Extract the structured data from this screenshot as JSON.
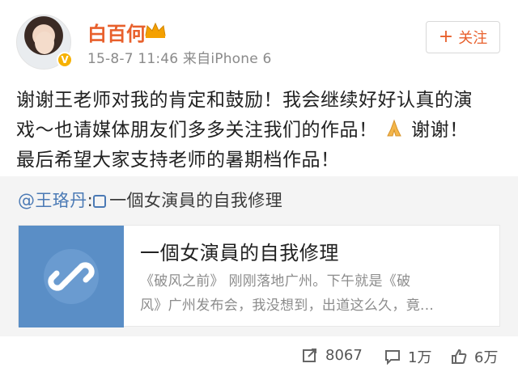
{
  "post": {
    "username": "白百何",
    "meta": "15-8-7 11:46 来自iPhone 6",
    "follow_label": "关注",
    "text_line1": "谢谢王老师对我的肯定和鼓励！我会继续好好认真的演",
    "text_line2a": "戏～也请媒体朋友们多多关注我们的作品！",
    "text_line2b": "谢谢！",
    "text_line3": "最后希望大家支持老师的暑期档作品！"
  },
  "repost": {
    "mention": "@王珞丹",
    "sep": ":",
    "link_text": "一個女演員的自我修理"
  },
  "card": {
    "title": "一個女演員的自我修理",
    "desc_line1": "《破风之前》 刚刚落地广州。下午就是《破",
    "desc_line2": "风》广州发布会，我没想到，出道这么久，竟..."
  },
  "actions": {
    "repost_count": "8067",
    "comment_count": "1万",
    "like_count": "6万"
  },
  "icons": {
    "verified": "verified-badge-icon",
    "crown": "crown-icon",
    "plus": "plus-icon",
    "pray": "pray-icon",
    "link": "link-icon",
    "repost": "repost-icon",
    "comment": "comment-icon",
    "like": "like-icon"
  },
  "colors": {
    "accent": "#e8602c",
    "link": "#4b7ab5",
    "thumb": "#5a8ec6",
    "badge": "#f6b100"
  }
}
